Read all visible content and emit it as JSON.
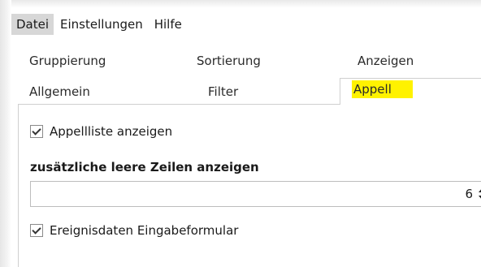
{
  "menu": {
    "items": [
      {
        "label": "Datei",
        "active": true
      },
      {
        "label": "Einstellungen",
        "active": false
      },
      {
        "label": "Hilfe",
        "active": false
      }
    ]
  },
  "tabs": {
    "top_row": [
      "Gruppierung",
      "Sortierung",
      "Anzeigen"
    ],
    "bottom_row": [
      "Allgemein",
      "Filter",
      "Appell"
    ],
    "selected": "Appell",
    "highlight_color": "#fff200"
  },
  "panel": {
    "show_appell_list": {
      "label": "Appellliste anzeigen",
      "checked": true
    },
    "empty_rows": {
      "label": "zusätzliche leere Zeilen anzeigen",
      "value": "6"
    },
    "event_form": {
      "label": "Ereignisdaten Eingabeformular",
      "checked": true
    }
  }
}
